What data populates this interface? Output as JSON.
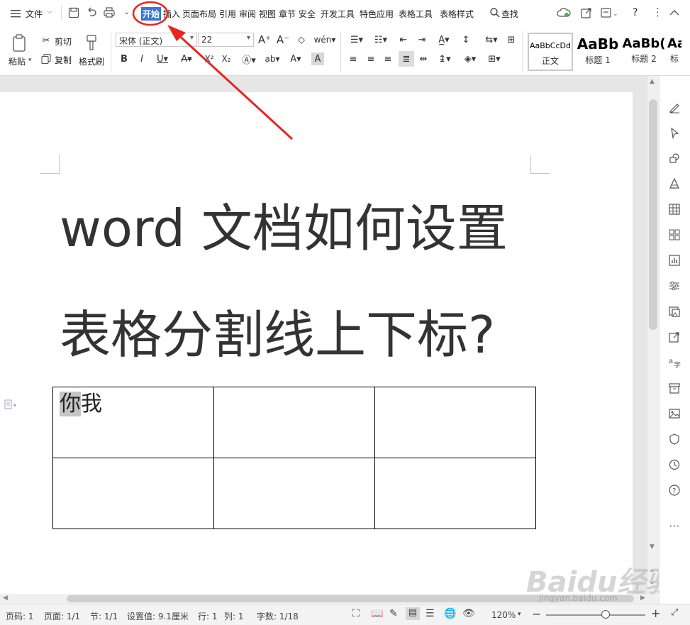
{
  "menubar": {
    "file_label": "文件",
    "tabs": [
      "开始",
      "插入",
      "页面布局",
      "引用",
      "审阅",
      "视图",
      "章节",
      "安全",
      "开发工具",
      "特色应用",
      "表格工具",
      "表格样式"
    ],
    "active_tab": "开始",
    "search_label": "查找",
    "help_label": "?"
  },
  "ribbon": {
    "paste_label": "粘贴",
    "cut_label": "剪切",
    "copy_label": "复制",
    "format_painter_label": "格式刷",
    "font_name": "宋体 (正文)",
    "font_size": "22",
    "styles": [
      {
        "sample": "AaBbCcDd",
        "name": "正文"
      },
      {
        "sample": "AaBb",
        "name": "标题 1"
      },
      {
        "sample": "AaBb(",
        "name": "标题 2"
      },
      {
        "sample": "Aa",
        "name": "标"
      }
    ]
  },
  "document": {
    "title_line1": "word 文档如何设置",
    "title_line2": "表格分割线上下标?",
    "table": {
      "rows": [
        [
          {
            "selected": "你",
            "rest": "我"
          },
          "",
          ""
        ],
        [
          "",
          "",
          ""
        ]
      ]
    }
  },
  "statusbar": {
    "page_no": "页码: 1",
    "pages": "页面: 1/1",
    "section": "节: 1/1",
    "setting": "设置值: 9.1厘米",
    "row": "行: 1",
    "column": "列: 1",
    "word_count": "字数: 1/18",
    "zoom": "120%",
    "zoom_level": 0.6
  },
  "watermark": {
    "logo": "Baidu经验",
    "url": "jingyan.baidu.com"
  },
  "colors": {
    "accent": "#3a76d6",
    "annotation": "#e8251f"
  },
  "icons": [
    "hamburger-icon",
    "save-icon",
    "undo-icon",
    "print-icon",
    "search-icon",
    "cloud-icon",
    "share-icon",
    "more-icon",
    "collapse-icon"
  ]
}
